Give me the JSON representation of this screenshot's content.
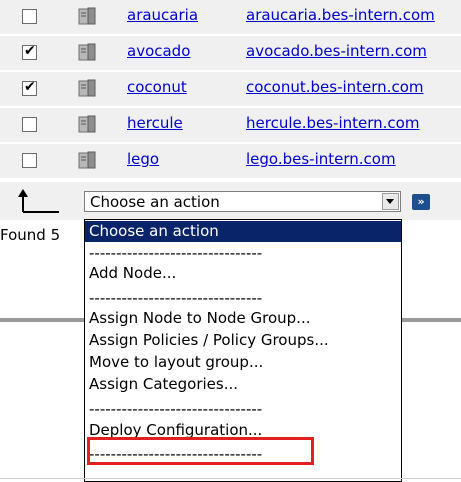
{
  "nodes": [
    {
      "checked": false,
      "host": "araucaria",
      "fqdn": "araucaria.bes-intern.com"
    },
    {
      "checked": true,
      "host": "avocado",
      "fqdn": "avocado.bes-intern.com"
    },
    {
      "checked": true,
      "host": "coconut",
      "fqdn": "coconut.bes-intern.com"
    },
    {
      "checked": false,
      "host": "hercule",
      "fqdn": "hercule.bes-intern.com"
    },
    {
      "checked": false,
      "host": "lego",
      "fqdn": "lego.bes-intern.com"
    }
  ],
  "action_bar": {
    "select_value": "Choose an action",
    "go_label": "»"
  },
  "found_text": "Found 5",
  "dropdown": {
    "options": [
      "Choose an action",
      "--------------------------------",
      "Add Node...",
      "--------------------------------",
      "Assign Node to Node Group...",
      "Assign Policies / Policy Groups...",
      "Move to layout group...",
      "Assign Categories...",
      "--------------------------------",
      "Deploy Configuration...",
      "--------------------------------"
    ],
    "selected_index": 0,
    "highlighted_option": "Deploy Configuration..."
  },
  "colors": {
    "link": "#0000cc",
    "row_bg": "#f0f0f0",
    "selected_bg": "#0a246a",
    "highlight_border": "#e32020",
    "go_button": "#1c4f8c"
  }
}
